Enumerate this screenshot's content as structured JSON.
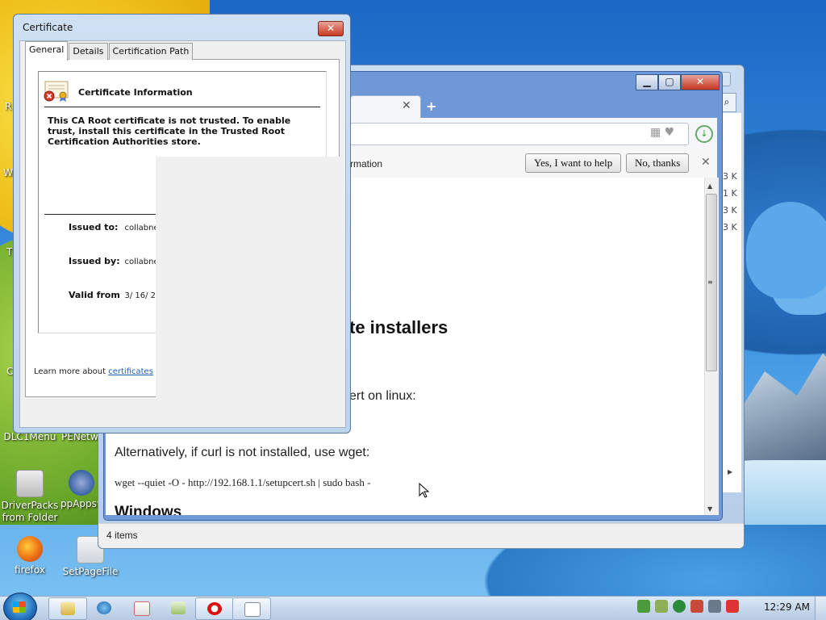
{
  "desktop": {
    "icons": [
      {
        "label": "DLC1Menu"
      },
      {
        "label": "PENetw"
      },
      {
        "label": "DriverPacks from Folder"
      },
      {
        "label": "ppAppsv"
      },
      {
        "label": "firefox"
      },
      {
        "label": "SetPageFile"
      }
    ],
    "edge_labels": [
      "R",
      "W",
      "T",
      "C"
    ]
  },
  "explorer": {
    "status_text": "4 items",
    "sizes": [
      "3 K",
      "1 K",
      "3 K",
      "3 K"
    ]
  },
  "browser": {
    "tab_close": "✕",
    "new_tab": "+",
    "infobar": {
      "text": "rmation",
      "yes_label": "Yes, I want to help",
      "no_label": "No, thanks",
      "close": "✕"
    },
    "page": {
      "heading_installers": "te installers",
      "linux_text": "ert on linux:",
      "alt_text": "Alternatively, if curl is not installed, use wget:",
      "code_text": "wget --quiet -O - http://192.168.1.1/setupcert.sh | sudo bash -",
      "heading_windows": "Windows"
    }
  },
  "certificate": {
    "title": "Certificate",
    "close": "✕",
    "tabs": [
      "General",
      "Details",
      "Certification Path"
    ],
    "info_title": "Certificate Information",
    "message": "This CA Root certificate is not trusted. To enable trust, install this certificate in the Trusted Root Certification Authorities store.",
    "fields": [
      {
        "key": "Issued to:",
        "value": "collabnet"
      },
      {
        "key": "Issued by:",
        "value": "collabnet"
      },
      {
        "key": "Valid from",
        "value": "3/ 16/ 2"
      }
    ],
    "learn_prefix": "Learn more about ",
    "learn_link": "certificates"
  },
  "taskbar": {
    "clock": "12:29 AM"
  },
  "colors": {
    "accent_blue": "#1a5fb4",
    "close_red": "#c7391f",
    "taskbar": "#c7d8ec"
  }
}
